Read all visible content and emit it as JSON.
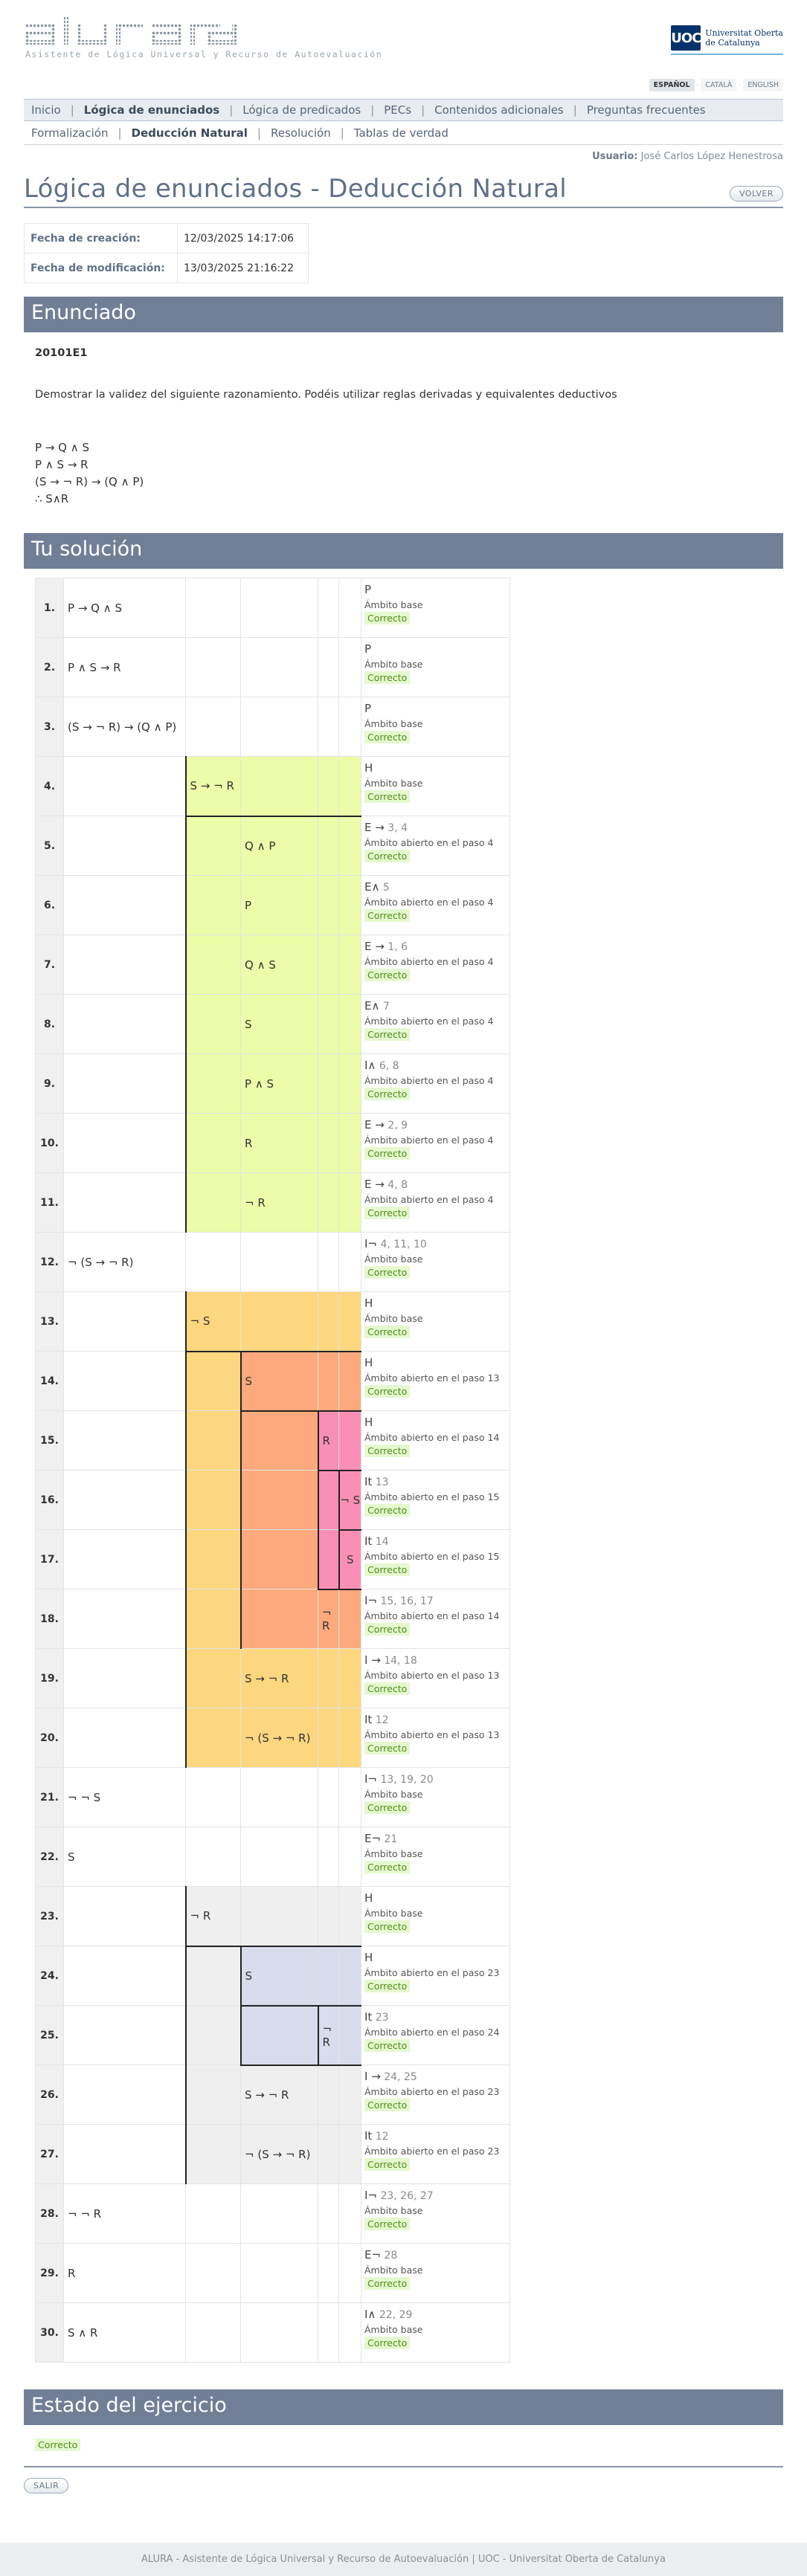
{
  "header": {
    "logo_text": "alura",
    "logo_subtitle": "Asistente de Lógica Universal y Recurso de Autoevaluación",
    "uoc_mark": "UOC",
    "uoc_line1": "Universitat Oberta",
    "uoc_line2": "de Catalunya"
  },
  "languages": [
    "ESPAÑOL",
    "CATALÀ",
    "ENGLISH"
  ],
  "mainnav": [
    "Inicio",
    "Lógica de enunciados",
    "Lógica de predicados",
    "PECs",
    "Contenidos adicionales",
    "Preguntas frecuentes"
  ],
  "subnav": [
    "Formalización",
    "Deducción Natural",
    "Resolución",
    "Tablas de verdad"
  ],
  "user": {
    "label": "Usuario:",
    "name": "José Carlos López Henestrosa"
  },
  "page_title": "Lógica de enunciados - Deducción Natural",
  "back_button": "VOLVER",
  "dates": [
    {
      "label": "Fecha de creación:",
      "value": "12/03/2025 14:17:06"
    },
    {
      "label": "Fecha de modificación:",
      "value": "13/03/2025 21:16:22"
    }
  ],
  "enunciado": {
    "heading": "Enunciado",
    "code": "20101E1",
    "description": "Demostrar la validez del siguiente razonamiento. Podéis utilizar reglas derivadas y equivalentes deductivos",
    "premises": [
      "P → Q ∧ S",
      "P ∧ S → R",
      "(S → ¬ R) → (Q ∧ P)"
    ],
    "conclusion": "∴ S∧R"
  },
  "solution_heading": "Tu solución",
  "proof_rows": [
    {
      "num": "1.",
      "col": 0,
      "formula": "P → Q ∧ S",
      "rule": "P",
      "refs": "",
      "scope": "Ámbito base",
      "status": "Correcto"
    },
    {
      "num": "2.",
      "col": 0,
      "formula": "P ∧ S → R",
      "rule": "P",
      "refs": "",
      "scope": "Ámbito base",
      "status": "Correcto"
    },
    {
      "num": "3.",
      "col": 0,
      "formula": "(S → ¬ R) → (Q ∧ P)",
      "rule": "P",
      "refs": "",
      "scope": "Ámbito base",
      "status": "Correcto"
    },
    {
      "num": "4.",
      "col": 1,
      "formula": "S → ¬ R",
      "rule": "H",
      "refs": "",
      "scope": "Ámbito base",
      "status": "Correcto"
    },
    {
      "num": "5.",
      "col": 2,
      "formula": "Q ∧ P",
      "rule": "E →",
      "refs": "3, 4",
      "scope": "Ámbito abierto en el paso 4",
      "status": "Correcto"
    },
    {
      "num": "6.",
      "col": 2,
      "formula": "P",
      "rule": "E∧",
      "refs": "5",
      "scope": "Ámbito abierto en el paso 4",
      "status": "Correcto"
    },
    {
      "num": "7.",
      "col": 2,
      "formula": "Q ∧ S",
      "rule": "E →",
      "refs": "1, 6",
      "scope": "Ámbito abierto en el paso 4",
      "status": "Correcto"
    },
    {
      "num": "8.",
      "col": 2,
      "formula": "S",
      "rule": "E∧",
      "refs": "7",
      "scope": "Ámbito abierto en el paso 4",
      "status": "Correcto"
    },
    {
      "num": "9.",
      "col": 2,
      "formula": "P ∧ S",
      "rule": "I∧",
      "refs": "6, 8",
      "scope": "Ámbito abierto en el paso 4",
      "status": "Correcto"
    },
    {
      "num": "10.",
      "col": 2,
      "formula": "R",
      "rule": "E →",
      "refs": "2, 9",
      "scope": "Ámbito abierto en el paso 4",
      "status": "Correcto"
    },
    {
      "num": "11.",
      "col": 2,
      "formula": "¬ R",
      "rule": "E →",
      "refs": "4, 8",
      "scope": "Ámbito abierto en el paso 4",
      "status": "Correcto"
    },
    {
      "num": "12.",
      "col": 0,
      "formula": "¬ (S → ¬ R)",
      "rule": "I¬",
      "refs": "4, 11, 10",
      "scope": "Ámbito base",
      "status": "Correcto"
    },
    {
      "num": "13.",
      "col": 1,
      "formula": "¬ S",
      "rule": "H",
      "refs": "",
      "scope": "Ámbito base",
      "status": "Correcto"
    },
    {
      "num": "14.",
      "col": 2,
      "formula": "S",
      "rule": "H",
      "refs": "",
      "scope": "Ámbito abierto en el paso 13",
      "status": "Correcto"
    },
    {
      "num": "15.",
      "col": 3,
      "formula": "R",
      "rule": "H",
      "refs": "",
      "scope": "Ámbito abierto en el paso 14",
      "status": "Correcto"
    },
    {
      "num": "16.",
      "col": 4,
      "formula": "¬ S",
      "rule": "It",
      "refs": "13",
      "scope": "Ámbito abierto en el paso 15",
      "status": "Correcto"
    },
    {
      "num": "17.",
      "col": 4,
      "formula": "S",
      "rule": "It",
      "refs": "14",
      "scope": "Ámbito abierto en el paso 15",
      "status": "Correcto"
    },
    {
      "num": "18.",
      "col": 3,
      "formula": "¬ R",
      "rule": "I¬",
      "refs": "15, 16, 17",
      "scope": "Ámbito abierto en el paso 14",
      "status": "Correcto"
    },
    {
      "num": "19.",
      "col": 2,
      "formula": "S → ¬ R",
      "rule": "I →",
      "refs": "14, 18",
      "scope": "Ámbito abierto en el paso 13",
      "status": "Correcto"
    },
    {
      "num": "20.",
      "col": 2,
      "formula": "¬ (S → ¬ R)",
      "rule": "It",
      "refs": "12",
      "scope": "Ámbito abierto en el paso 13",
      "status": "Correcto"
    },
    {
      "num": "21.",
      "col": 0,
      "formula": "¬ ¬ S",
      "rule": "I¬",
      "refs": "13, 19, 20",
      "scope": "Ámbito base",
      "status": "Correcto"
    },
    {
      "num": "22.",
      "col": 0,
      "formula": "S",
      "rule": "E¬",
      "refs": "21",
      "scope": "Ámbito base",
      "status": "Correcto"
    },
    {
      "num": "23.",
      "col": 1,
      "formula": "¬ R",
      "rule": "H",
      "refs": "",
      "scope": "Ámbito base",
      "status": "Correcto"
    },
    {
      "num": "24.",
      "col": 2,
      "formula": "S",
      "rule": "H",
      "refs": "",
      "scope": "Ámbito abierto en el paso 23",
      "status": "Correcto"
    },
    {
      "num": "25.",
      "col": 3,
      "formula": "¬ R",
      "rule": "It",
      "refs": "23",
      "scope": "Ámbito abierto en el paso 24",
      "status": "Correcto"
    },
    {
      "num": "26.",
      "col": 2,
      "formula": "S → ¬ R",
      "rule": "I →",
      "refs": "24, 25",
      "scope": "Ámbito abierto en el paso 23",
      "status": "Correcto"
    },
    {
      "num": "27.",
      "col": 2,
      "formula": "¬ (S → ¬ R)",
      "rule": "It",
      "refs": "12",
      "scope": "Ámbito abierto en el paso 23",
      "status": "Correcto"
    },
    {
      "num": "28.",
      "col": 0,
      "formula": "¬ ¬ R",
      "rule": "I¬",
      "refs": "23, 26, 27",
      "scope": "Ámbito base",
      "status": "Correcto"
    },
    {
      "num": "29.",
      "col": 0,
      "formula": "R",
      "rule": "E¬",
      "refs": "28",
      "scope": "Ámbito base",
      "status": "Correcto"
    },
    {
      "num": "30.",
      "col": 0,
      "formula": "S ∧ R",
      "rule": "I∧",
      "refs": "22, 29",
      "scope": "Ámbito base",
      "status": "Correcto"
    }
  ],
  "scope_colors": {
    "yellow_green": "#ecfca8",
    "orange": "#fdd680",
    "salmon": "#fca97d",
    "pink": "#f98fb4",
    "light_gray": "#efefef",
    "lavender": "#d9dcec"
  },
  "estado": {
    "heading": "Estado del ejercicio",
    "status": "Correcto"
  },
  "exit_button": "SALIR",
  "footer": "ALURA - Asistente de Lógica Universal y Recurso de Autoevaluación | UOC - Universitat Oberta de Catalunya"
}
